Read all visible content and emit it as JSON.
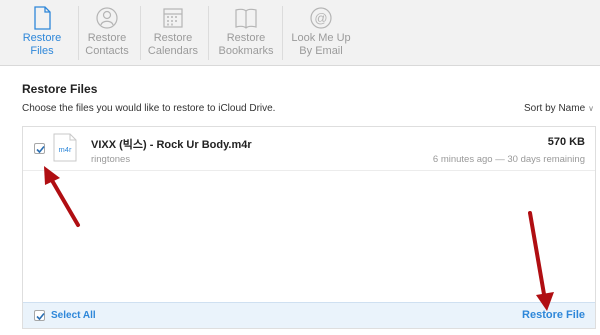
{
  "toolbar": {
    "items": [
      {
        "label": "Restore\nFiles",
        "icon": "file-icon",
        "active": true
      },
      {
        "label": "Restore\nContacts",
        "icon": "contact-icon",
        "active": false
      },
      {
        "label": "Restore\nCalendars",
        "icon": "calendar-icon",
        "active": false
      },
      {
        "label": "Restore\nBookmarks",
        "icon": "book-icon",
        "active": false
      },
      {
        "label": "Look Me Up\nBy Email",
        "icon": "at-icon",
        "active": false
      }
    ],
    "accent": "#2e87d9"
  },
  "main": {
    "title": "Restore Files",
    "instructions": "Choose the files you would like to restore to iCloud Drive.",
    "sort_label": "Sort by Name"
  },
  "files": [
    {
      "ext": "m4r",
      "name": "VIXX (빅스) - Rock Ur Body.m4r",
      "folder": "ringtones",
      "size": "570 KB",
      "meta": "6 minutes ago — 30 days remaining",
      "checked": true
    }
  ],
  "footer": {
    "select_all": "Select All",
    "restore_button": "Restore File"
  }
}
